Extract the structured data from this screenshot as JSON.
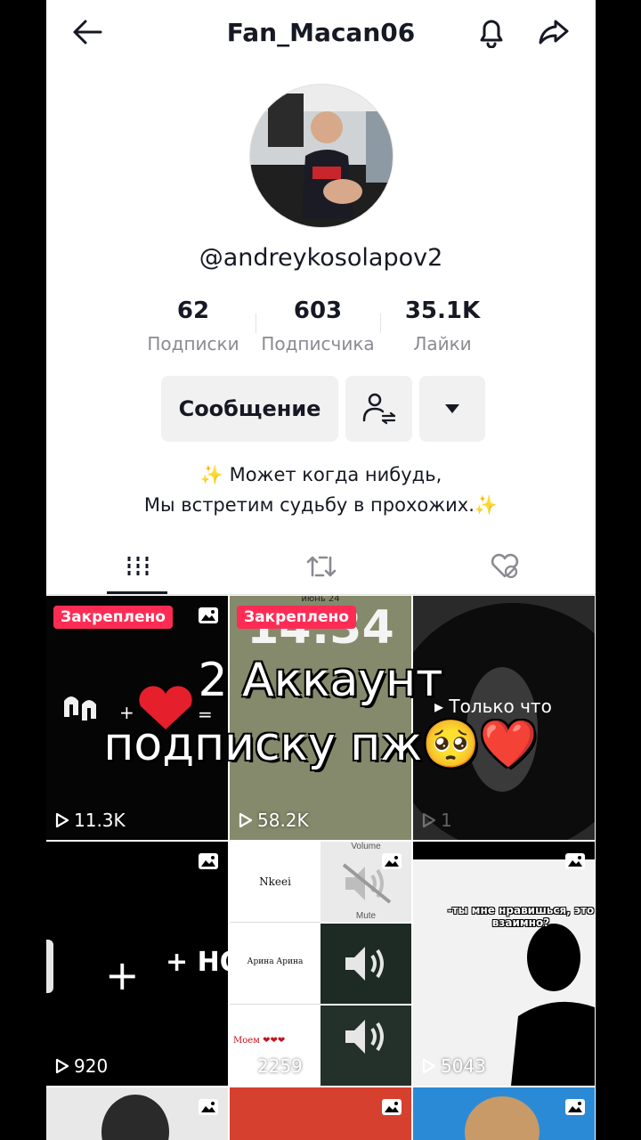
{
  "header": {
    "title": "Fan_Macan06"
  },
  "profile": {
    "username": "@andreykosolapov2",
    "stats": [
      {
        "value": "62",
        "label": "Подписки"
      },
      {
        "value": "603",
        "label": "Подписчика"
      },
      {
        "value": "35.1K",
        "label": "Лайки"
      }
    ],
    "message_button": "Сообщение",
    "bio_line1": "Может когда нибудь,",
    "bio_line2": "Мы встретим судьбу в прохожих.",
    "sparkle": "✨"
  },
  "tabs": [
    "videos-grid-icon",
    "repost-icon",
    "liked-hidden-icon"
  ],
  "grid": {
    "pinned_label": "Закреплено",
    "items": [
      {
        "views": "11.3K",
        "pinned": true,
        "text": ""
      },
      {
        "views": "58.2K",
        "pinned": true,
        "text": "14:34"
      },
      {
        "views": "1",
        "pinned": false,
        "text": "Только что"
      },
      {
        "views": "920",
        "pinned": false,
        "text": "+ НОЧ ПРО"
      },
      {
        "views": "2259",
        "pinned": false,
        "text": "Nkeei"
      },
      {
        "views": "5043",
        "pinned": false,
        "text": "-ты мне нравишься, это взаимно?"
      }
    ],
    "cell5_labels": [
      "Nkeei",
      "Арина Арина",
      "Моем ❤❤❤"
    ],
    "cell5_volume": "Volume",
    "cell5_mute": "Mute",
    "cell2_top": "июнь 24"
  },
  "overlay": {
    "line1": "2 Аккаунт",
    "line2": "подписку пж🥺❤️"
  },
  "colors": {
    "accent": "#fe2c55",
    "text": "#161823",
    "muted": "#8a8b91"
  }
}
